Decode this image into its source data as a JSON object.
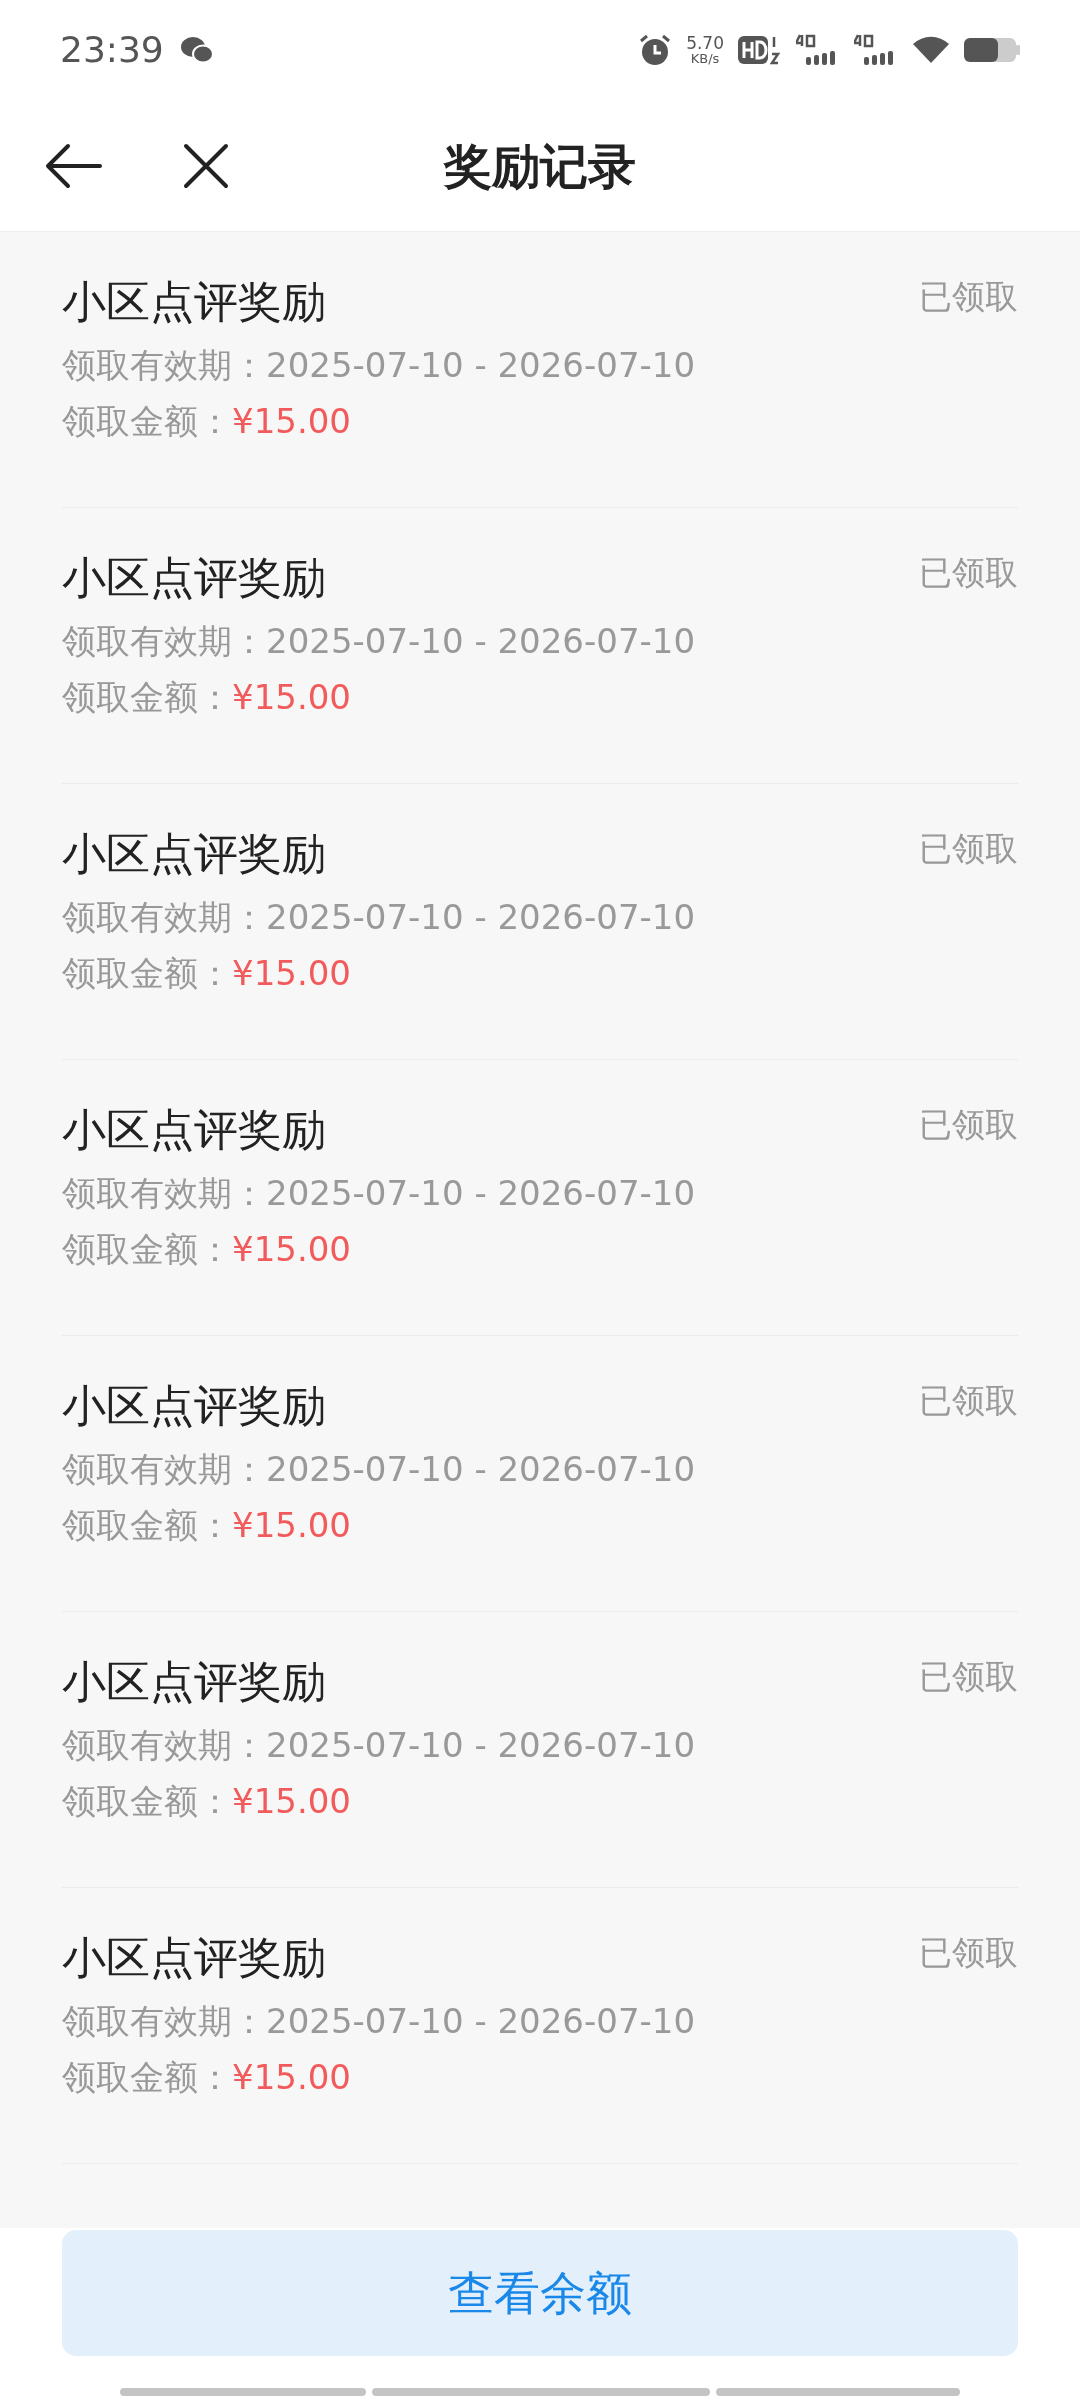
{
  "status_bar": {
    "time": "23:39",
    "speed": "5.70",
    "speed_unit": "KB/s"
  },
  "header": {
    "title": "奖励记录"
  },
  "records": [
    {
      "title": "小区点评奖励",
      "status": "已领取",
      "validity_label": "领取有效期：",
      "validity": "2025-07-10 - 2026-07-10",
      "amount_label": "领取金额：",
      "amount": "¥15.00"
    },
    {
      "title": "小区点评奖励",
      "status": "已领取",
      "validity_label": "领取有效期：",
      "validity": "2025-07-10 - 2026-07-10",
      "amount_label": "领取金额：",
      "amount": "¥15.00"
    },
    {
      "title": "小区点评奖励",
      "status": "已领取",
      "validity_label": "领取有效期：",
      "validity": "2025-07-10 - 2026-07-10",
      "amount_label": "领取金额：",
      "amount": "¥15.00"
    },
    {
      "title": "小区点评奖励",
      "status": "已领取",
      "validity_label": "领取有效期：",
      "validity": "2025-07-10 - 2026-07-10",
      "amount_label": "领取金额：",
      "amount": "¥15.00"
    },
    {
      "title": "小区点评奖励",
      "status": "已领取",
      "validity_label": "领取有效期：",
      "validity": "2025-07-10 - 2026-07-10",
      "amount_label": "领取金额：",
      "amount": "¥15.00"
    },
    {
      "title": "小区点评奖励",
      "status": "已领取",
      "validity_label": "领取有效期：",
      "validity": "2025-07-10 - 2026-07-10",
      "amount_label": "领取金额：",
      "amount": "¥15.00"
    },
    {
      "title": "小区点评奖励",
      "status": "已领取",
      "validity_label": "领取有效期：",
      "validity": "2025-07-10 - 2026-07-10",
      "amount_label": "领取金额：",
      "amount": "¥15.00"
    }
  ],
  "bottom_button": "查看余额"
}
